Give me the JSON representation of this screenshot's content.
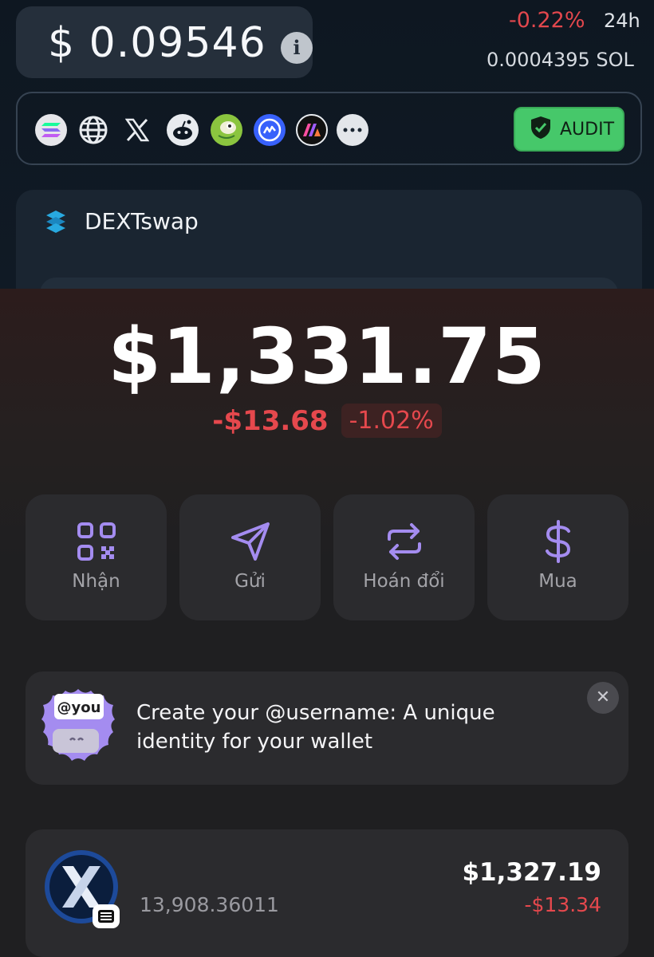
{
  "token_header": {
    "price": "$ 0.09546",
    "change": "-0.22%",
    "period": "24h",
    "price_sol": "0.0004395  SOL",
    "audit_label": "AUDIT"
  },
  "dext": {
    "title": "DEXTswap"
  },
  "wallet": {
    "balance": "$1,331.75",
    "change_abs": "-$13.68",
    "change_pct": "-1.02%",
    "actions": [
      {
        "label": "Nhận",
        "icon": "qr-code-icon"
      },
      {
        "label": "Gửi",
        "icon": "send-icon"
      },
      {
        "label": "Hoán đổi",
        "icon": "swap-icon"
      },
      {
        "label": "Mua",
        "icon": "dollar-icon"
      }
    ],
    "promo": {
      "badge": "@you",
      "text": "Create your @username: A unique identity for your wallet"
    },
    "tokens": [
      {
        "amount": "13,908.36011",
        "value": "$1,327.19",
        "change": "-$13.34"
      }
    ]
  },
  "colors": {
    "accent_purple": "#a48cf0",
    "negative_red": "#e5484d",
    "audit_green": "#46c86a"
  }
}
